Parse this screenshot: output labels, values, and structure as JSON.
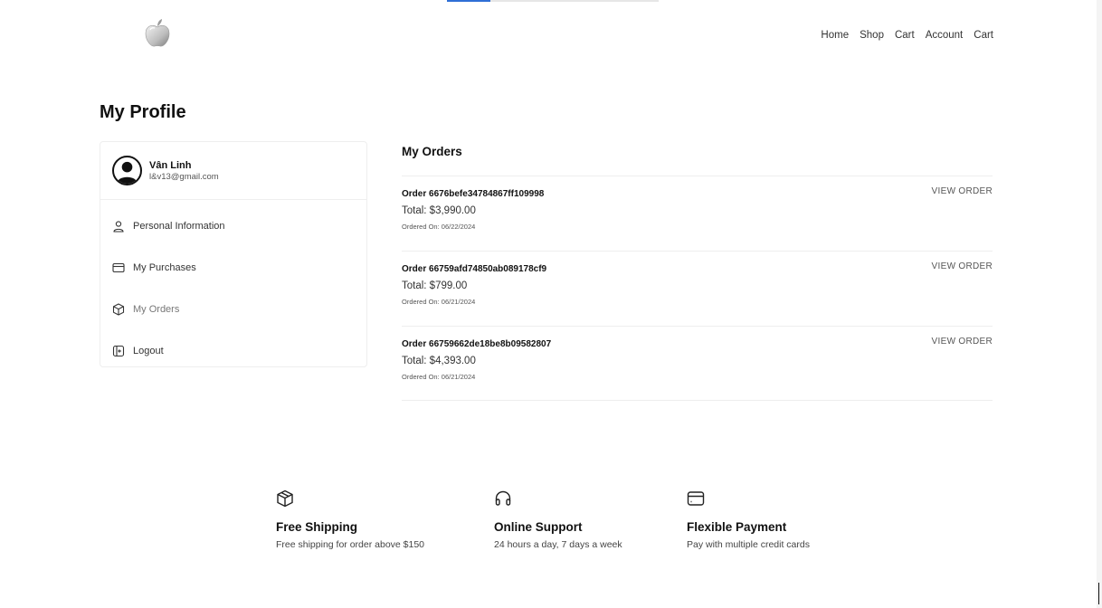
{
  "header": {
    "nav": [
      "Home",
      "Shop",
      "Cart",
      "Account",
      "Cart"
    ]
  },
  "page": {
    "title": "My Profile"
  },
  "profile": {
    "name": "Vân Linh",
    "email": "l&v13@gmail.com"
  },
  "sidebar": {
    "items": [
      {
        "label": "Personal Information",
        "icon": "user-icon"
      },
      {
        "label": "My Purchases",
        "icon": "card-icon"
      },
      {
        "label": "My Orders",
        "icon": "box-icon"
      },
      {
        "label": "Logout",
        "icon": "logout-icon"
      }
    ]
  },
  "orders": {
    "title": "My Orders",
    "view_label": "VIEW ORDER",
    "items": [
      {
        "id": "Order 6676befe34784867ff109998",
        "total": "Total: $3,990.00",
        "date": "Ordered On: 06/22/2024"
      },
      {
        "id": "Order 66759afd74850ab089178cf9",
        "total": "Total: $799.00",
        "date": "Ordered On: 06/21/2024"
      },
      {
        "id": "Order 66759662de18be8b09582807",
        "total": "Total: $4,393.00",
        "date": "Ordered On: 06/21/2024"
      }
    ]
  },
  "features": [
    {
      "icon": "box-icon",
      "title": "Free Shipping",
      "desc": "Free shipping for order above $150"
    },
    {
      "icon": "headphones-icon",
      "title": "Online Support",
      "desc": "24 hours a day, 7 days a week"
    },
    {
      "icon": "card-icon",
      "title": "Flexible Payment",
      "desc": "Pay with multiple credit cards"
    }
  ],
  "colors": {
    "accent": "#2f6fd6",
    "text": "#222222",
    "border": "#eeeeee"
  }
}
